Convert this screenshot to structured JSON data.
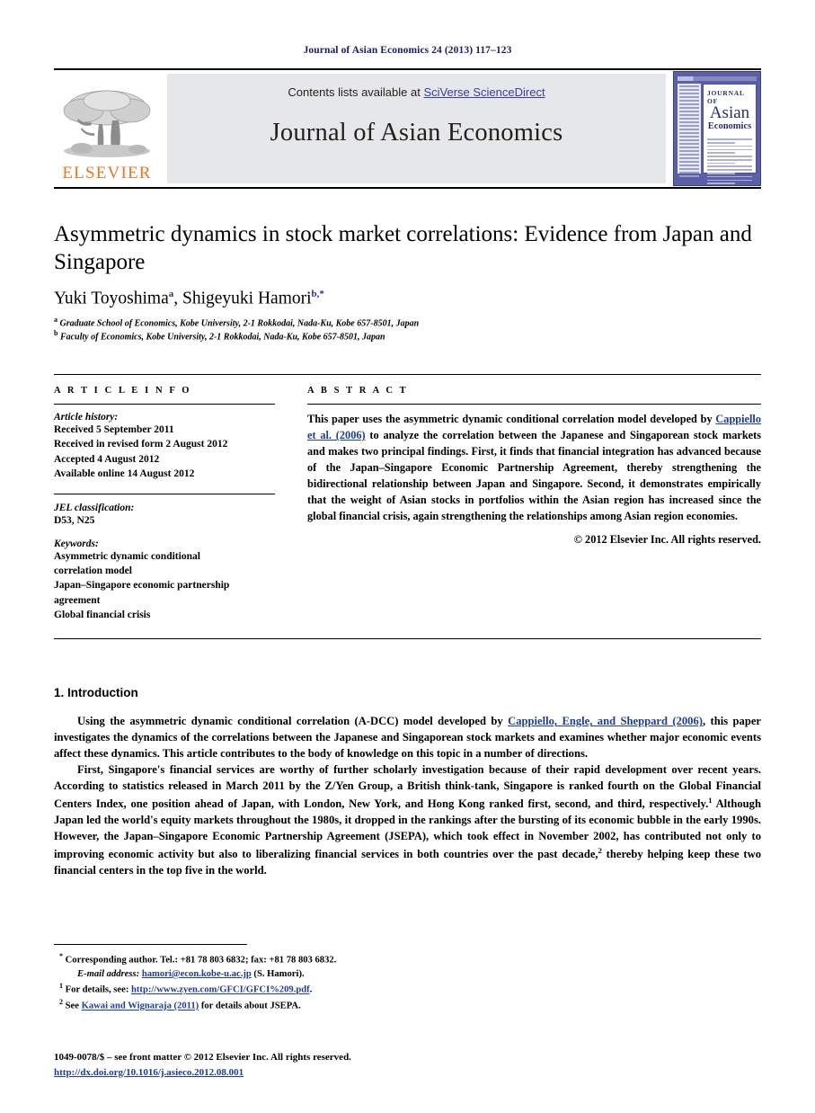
{
  "running_head": "Journal of Asian Economics 24 (2013) 117–123",
  "masthead": {
    "publisher_logo_text": "ELSEVIER",
    "contents_prefix": "Contents lists available at ",
    "contents_link": "SciVerse ScienceDirect",
    "journal_name": "Journal of Asian Economics",
    "cover": {
      "line1": "JOURNAL OF",
      "line2": "Asian",
      "line3": "Economics"
    }
  },
  "article": {
    "title": "Asymmetric dynamics in stock market correlations: Evidence from Japan and Singapore",
    "authors": "Yuki Toyoshima , Shigeyuki Hamori",
    "author1": "Yuki Toyoshima",
    "author1_sup": "a",
    "author2": "Shigeyuki Hamori",
    "author2_sup": "b,*",
    "affiliation_a": "Graduate School of Economics, Kobe University, 2-1 Rokkodai, Nada-Ku, Kobe 657-8501, Japan",
    "affiliation_b": "Faculty of Economics, Kobe University, 2-1 Rokkodai, Nada-Ku, Kobe 657-8501, Japan"
  },
  "article_info": {
    "heading": "A R T I C L E   I N F O",
    "history_label": "Article history:",
    "history": [
      "Received 5 September 2011",
      "Received in revised form 2 August 2012",
      "Accepted 4 August 2012",
      "Available online 14 August 2012"
    ],
    "jel_label": "JEL classification:",
    "jel_value": "D53, N25",
    "keywords_label": "Keywords:",
    "keywords": [
      "Asymmetric dynamic conditional",
      "correlation model",
      "Japan–Singapore economic partnership",
      "agreement",
      "Global financial crisis"
    ]
  },
  "abstract": {
    "heading": "A B S T R A C T",
    "part1": "This paper uses the asymmetric dynamic conditional correlation model developed by ",
    "citation": "Cappiello et al. (2006)",
    "part2": " to analyze the correlation between the Japanese and Singaporean stock markets and makes two principal findings. First, it finds that financial integration has advanced because of the Japan–Singapore Economic Partnership Agreement, thereby strengthening the bidirectional relationship between Japan and Singapore. Second, it demonstrates empirically that the weight of Asian stocks in portfolios within the Asian region has increased since the global financial crisis, again strengthening the relationships among Asian region economies.",
    "copyright": "© 2012 Elsevier Inc. All rights reserved."
  },
  "sections": {
    "intro_heading": "1. Introduction",
    "para1_a": "Using the asymmetric dynamic conditional correlation (A-DCC) model developed by ",
    "para1_cite": "Cappiello, Engle, and Sheppard (2006)",
    "para1_b": ", this paper investigates the dynamics of the correlations between the Japanese and Singaporean stock markets and examines whether major economic events affect these dynamics. This article contributes to the body of knowledge on this topic in a number of directions.",
    "para2_a": "First, Singapore's financial services are worthy of further scholarly investigation because of their rapid development over recent years. According to statistics released in March 2011 by the Z/Yen Group, a British think-tank, Singapore is ranked fourth on the Global Financial Centers Index, one position ahead of Japan, with London, New York, and Hong Kong ranked first, second, and third, respectively.",
    "para2_sup1": "1",
    "para2_b": " Although Japan led the world's equity markets throughout the 1980s, it dropped in the rankings after the bursting of its economic bubble in the early 1990s. However, the Japan–Singapore Economic Partnership Agreement (JSEPA), which took effect in November 2002, has contributed not only to improving economic activity but also to liberalizing financial services in both countries over the past decade,",
    "para2_sup2": "2",
    "para2_c": " thereby helping keep these two financial centers in the top five in the world."
  },
  "footnotes": {
    "corresponding_marker": "*",
    "corresponding": "Corresponding author. Tel.: +81 78 803 6832; fax: +81 78 803 6832.",
    "email_label": "E-mail address:",
    "email": "hamori@econ.kobe-u.ac.jp",
    "email_suffix": " (S. Hamori).",
    "fn1_marker": "1",
    "fn1_text": "For details, see: ",
    "fn1_link": "http://www.zyen.com/GFCI/GFCI%209.pdf",
    "fn1_end": ".",
    "fn2_marker": "2",
    "fn2_prefix": "See ",
    "fn2_link": "Kawai and Wignaraja (2011)",
    "fn2_suffix": " for details about JSEPA."
  },
  "colophon": {
    "line1": "1049-0078/$ – see front matter © 2012 Elsevier Inc. All rights reserved.",
    "doi": "http://dx.doi.org/10.1016/j.asieco.2012.08.001"
  },
  "colors": {
    "link": "#1f3c94",
    "running_head": "#1a1a6e",
    "elsevier_orange": "#E87722",
    "masthead_gray": "#e6e7e8",
    "cover_blue": "#5a5fa8"
  }
}
